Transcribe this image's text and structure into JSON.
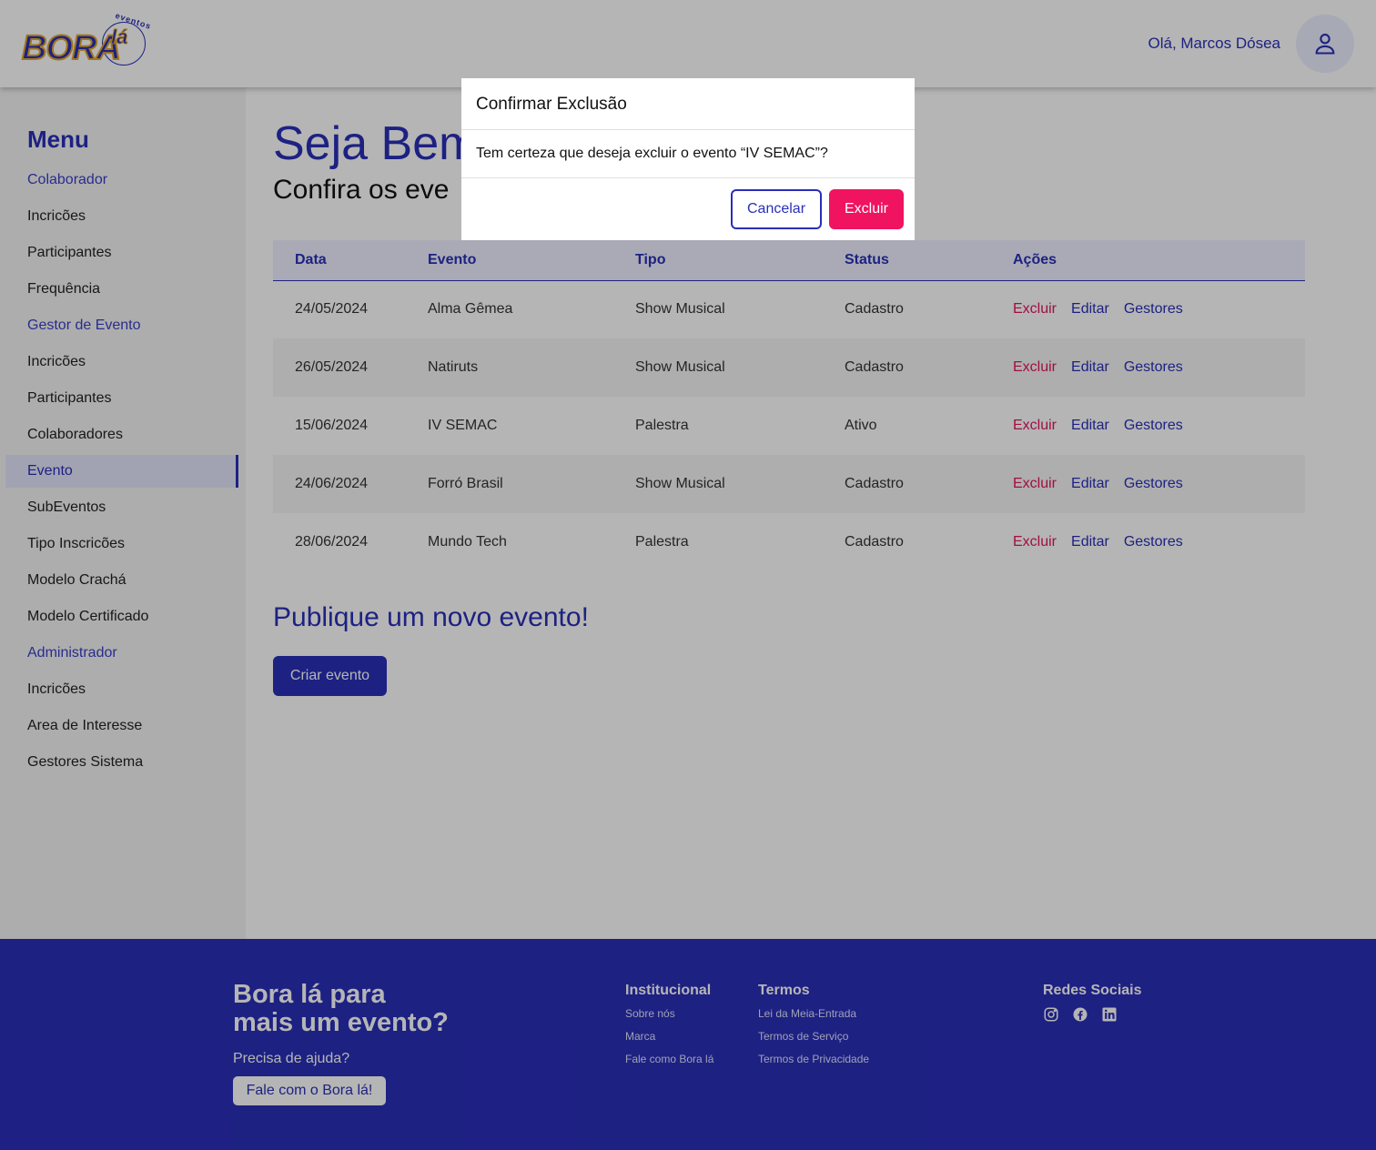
{
  "header": {
    "logo_text": "BORA",
    "logo_la": "lá",
    "logo_sub": "eventos",
    "greeting": "Olá, Marcos Dósea",
    "avatar_icon": "user-icon"
  },
  "sidebar": {
    "title": "Menu",
    "items": [
      {
        "label": "Colaborador",
        "type": "section"
      },
      {
        "label": "Incricões",
        "type": "item"
      },
      {
        "label": "Participantes",
        "type": "item"
      },
      {
        "label": "Frequência",
        "type": "item"
      },
      {
        "label": "Gestor de Evento",
        "type": "section"
      },
      {
        "label": "Incricões",
        "type": "item"
      },
      {
        "label": "Participantes",
        "type": "item"
      },
      {
        "label": "Colaboradores",
        "type": "item"
      },
      {
        "label": "Evento",
        "type": "active"
      },
      {
        "label": "SubEventos",
        "type": "item"
      },
      {
        "label": "Tipo Inscricões",
        "type": "item"
      },
      {
        "label": "Modelo Crachá",
        "type": "item"
      },
      {
        "label": "Modelo Certificado",
        "type": "item"
      },
      {
        "label": "Administrador",
        "type": "section"
      },
      {
        "label": "Incricões",
        "type": "item"
      },
      {
        "label": "Area de Interesse",
        "type": "item"
      },
      {
        "label": "Gestores Sistema",
        "type": "item"
      }
    ]
  },
  "main": {
    "welcome": "Seja Bem",
    "subtitle": "Confira os eve",
    "table": {
      "headers": [
        "Data",
        "Evento",
        "Tipo",
        "Status",
        "Ações"
      ],
      "rows": [
        {
          "data": "24/05/2024",
          "evento": "Alma Gêmea",
          "tipo": "Show Musical",
          "status": "Cadastro"
        },
        {
          "data": "26/05/2024",
          "evento": "Natiruts",
          "tipo": "Show Musical",
          "status": "Cadastro"
        },
        {
          "data": "15/06/2024",
          "evento": "IV SEMAC",
          "tipo": "Palestra",
          "status": "Ativo"
        },
        {
          "data": "24/06/2024",
          "evento": "Forró Brasil",
          "tipo": "Show Musical",
          "status": "Cadastro"
        },
        {
          "data": "28/06/2024",
          "evento": "Mundo Tech",
          "tipo": "Palestra",
          "status": "Cadastro"
        }
      ],
      "actions": {
        "delete": "Excluir",
        "edit": "Editar",
        "managers": "Gestores"
      }
    },
    "publish_title": "Publique um novo evento!",
    "create_button": "Criar evento"
  },
  "footer": {
    "headline_1": "Bora lá para",
    "headline_2": "mais um evento?",
    "help_text": "Precisa de ajuda?",
    "help_button": "Fale com o Bora lá!",
    "institucional": {
      "title": "Institucional",
      "links": [
        "Sobre nós",
        "Marca",
        "Fale como Bora lá"
      ]
    },
    "termos": {
      "title": "Termos",
      "links": [
        "Lei da Meia-Entrada",
        "Termos de Serviço",
        "Termos de Privacidade"
      ]
    },
    "social": {
      "title": "Redes Sociais",
      "icons": [
        "instagram-icon",
        "facebook-icon",
        "linkedin-icon"
      ]
    }
  },
  "modal": {
    "title": "Confirmar Exclusão",
    "message": "Tem certeza que deseja excluir o evento “IV SEMAC”?",
    "cancel": "Cancelar",
    "confirm": "Excluir"
  },
  "colors": {
    "primary": "#2a2fb8",
    "danger": "#f0135f",
    "logo_outline": "#e2a72e"
  }
}
